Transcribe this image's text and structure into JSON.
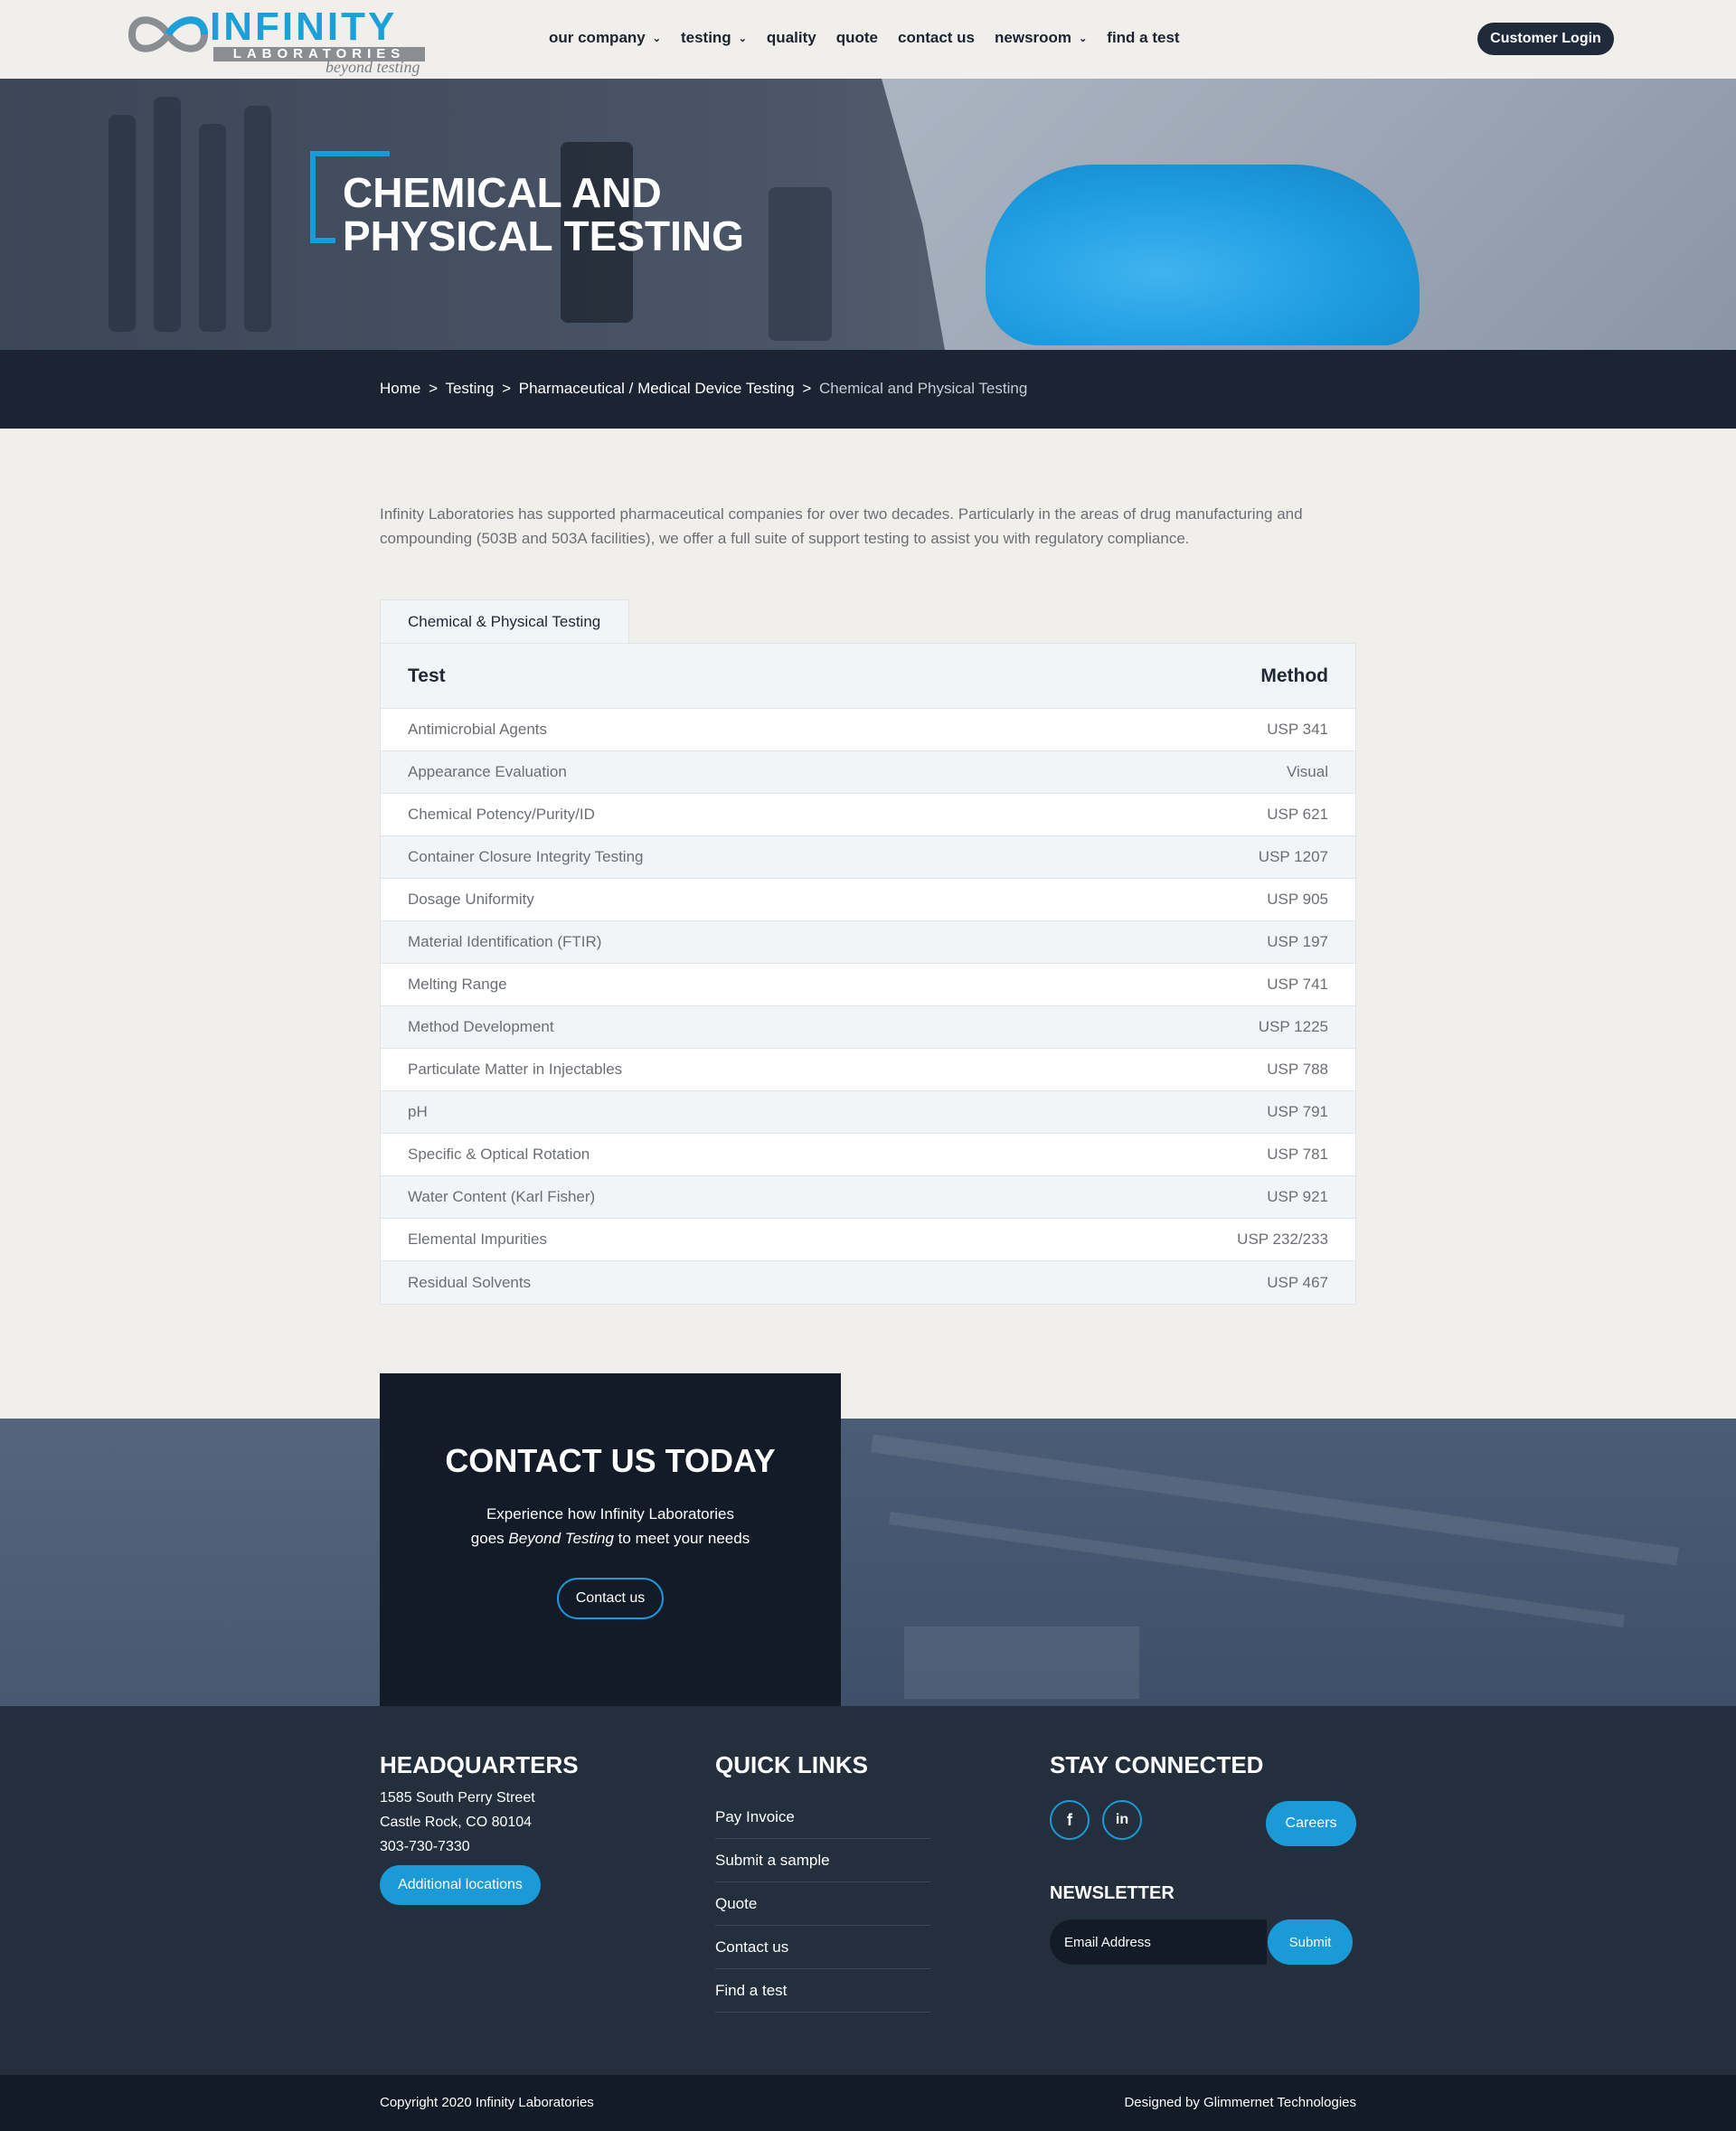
{
  "header": {
    "logo_main": "INFINITY",
    "logo_sub": "LABORATORIES",
    "logo_tag": "beyond testing",
    "nav": [
      {
        "label": "our company",
        "has_dropdown": true
      },
      {
        "label": "testing",
        "has_dropdown": true
      },
      {
        "label": "quality",
        "has_dropdown": false
      },
      {
        "label": "quote",
        "has_dropdown": false
      },
      {
        "label": "contact us",
        "has_dropdown": false
      },
      {
        "label": "newsroom",
        "has_dropdown": true
      },
      {
        "label": "find a test",
        "has_dropdown": false
      }
    ],
    "login_label": "Customer Login"
  },
  "hero": {
    "title": "CHEMICAL AND PHYSICAL TESTING"
  },
  "breadcrumb": {
    "items": [
      "Home",
      "Testing",
      "Pharmaceutical / Medical Device Testing"
    ],
    "separator": ">",
    "current": "Chemical and Physical Testing"
  },
  "intro": "Infinity Laboratories has supported pharmaceutical companies for over two decades. Particularly in the areas of drug manufacturing and compounding (503B and 503A facilities), we offer a full suite of support testing to assist you with regulatory compliance.",
  "tab": {
    "label": "Chemical & Physical Testing"
  },
  "table": {
    "headers": [
      "Test",
      "Method"
    ],
    "rows": [
      [
        "Antimicrobial Agents",
        "USP 341"
      ],
      [
        "Appearance Evaluation",
        "Visual"
      ],
      [
        "Chemical Potency/Purity/ID",
        "USP 621"
      ],
      [
        "Container Closure Integrity Testing",
        "USP 1207"
      ],
      [
        "Dosage Uniformity",
        "USP 905"
      ],
      [
        "Material Identification (FTIR)",
        "USP 197"
      ],
      [
        "Melting Range",
        "USP 741"
      ],
      [
        "Method Development",
        "USP 1225"
      ],
      [
        "Particulate Matter in Injectables",
        "USP 788"
      ],
      [
        "pH",
        "USP 791"
      ],
      [
        "Specific & Optical Rotation",
        "USP 781"
      ],
      [
        "Water Content (Karl Fisher)",
        "USP 921"
      ],
      [
        "Elemental Impurities",
        "USP 232/233"
      ],
      [
        "Residual Solvents",
        "USP 467"
      ]
    ]
  },
  "contact": {
    "title": "CONTACT US TODAY",
    "text_line1": "Experience how Infinity Laboratories",
    "text_line2_pre": "goes ",
    "text_line2_em": "Beyond Testing",
    "text_line2_post": " to meet your needs",
    "button": "Contact us"
  },
  "footer": {
    "hq_title": "HEADQUARTERS",
    "hq_lines": [
      "1585 South Perry Street",
      "Castle Rock, CO 80104",
      "303-730-7330"
    ],
    "locations_btn": "Additional locations",
    "ql_title": "QUICK LINKS",
    "quick_links": [
      "Pay Invoice",
      "Submit a sample",
      "Quote",
      "Contact us",
      "Find a test"
    ],
    "sc_title": "STAY CONNECTED",
    "social": [
      {
        "icon": "facebook-icon",
        "glyph": "f"
      },
      {
        "icon": "linkedin-icon",
        "glyph": "in"
      }
    ],
    "careers_btn": "Careers",
    "newsletter_title": "NEWSLETTER",
    "newsletter_placeholder": "Email Address",
    "newsletter_submit": "Submit"
  },
  "bottom": {
    "copyright": "Copyright 2020 Infinity Laboratories",
    "designer": "Designed by Glimmernet Technologies"
  },
  "colors": {
    "accent": "#1a9ad6",
    "dark_navy": "#1c2433",
    "footer_bg": "#242f3e",
    "page_bg": "#f0efec"
  }
}
